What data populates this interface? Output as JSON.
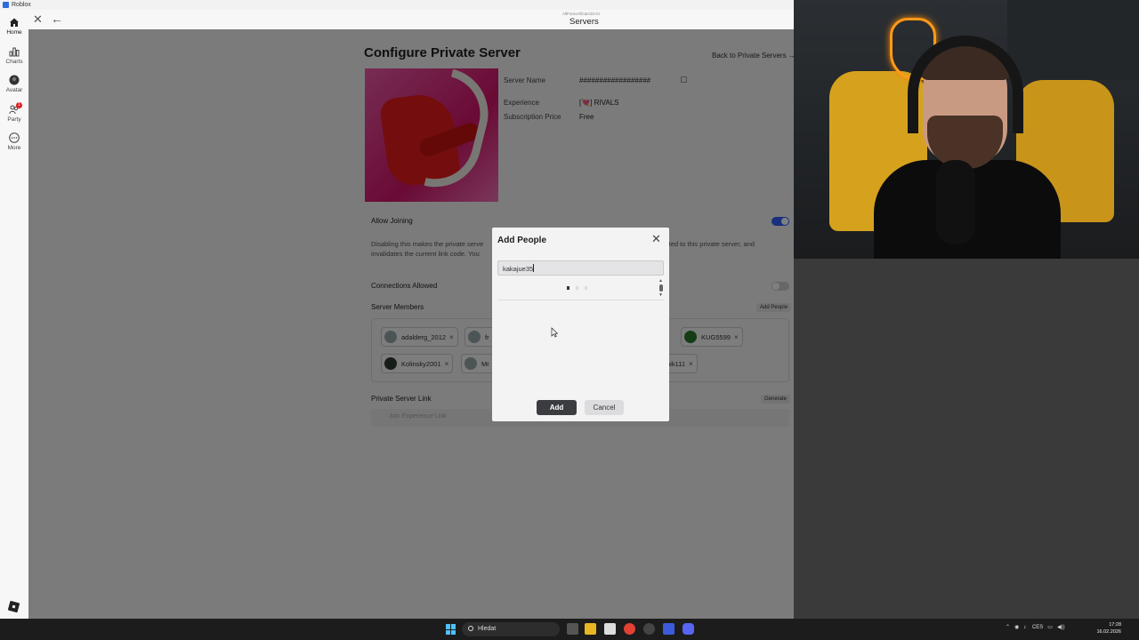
{
  "window": {
    "title": "Roblox",
    "header_subtitle": "AllForexAllCatADI.Gr",
    "header_title": "Servers"
  },
  "nav": {
    "home": "Home",
    "charts": "Charts",
    "avatar": "Avatar",
    "party": "Party",
    "party_badge": "1",
    "more": "More"
  },
  "page": {
    "title": "Configure Private Server",
    "back_link": "Back to Private Servers →",
    "server_name_label": "Server Name",
    "server_name_value": "##################",
    "experience_label": "Experience",
    "experience_value": "[💘] RIVALS",
    "subscription_label": "Subscription Price",
    "subscription_value": "Free",
    "allow_joining_label": "Allow Joining",
    "allow_joining_desc_left": "Disabling this makes the private serve",
    "allow_joining_desc_left2": "invalidates the current link code. You",
    "allow_joining_desc_right": "ited to this private server, and",
    "connections_label": "Connections Allowed",
    "members_label": "Server Members",
    "add_people_button": "Add People",
    "link_label": "Private Server Link",
    "generate_button": "Generate",
    "link_placeholder": "Join Experience Link"
  },
  "members": [
    {
      "name": "adalderg_2012"
    },
    {
      "name": "fr"
    },
    {
      "name": "KUG5599"
    },
    {
      "name": "Kolinsky2001"
    },
    {
      "name": "Mr"
    },
    {
      "name": "bik111"
    }
  ],
  "dialog": {
    "title": "Add People",
    "input_value": "kakajue35",
    "add_button": "Add",
    "cancel_button": "Cancel"
  },
  "taskbar": {
    "search_placeholder": "Hledat",
    "lang": "CES",
    "time": "17:28",
    "date": "16.02.2026"
  },
  "colors": {
    "accent": "#335fff",
    "dialog_primary": "#3b3c40"
  }
}
